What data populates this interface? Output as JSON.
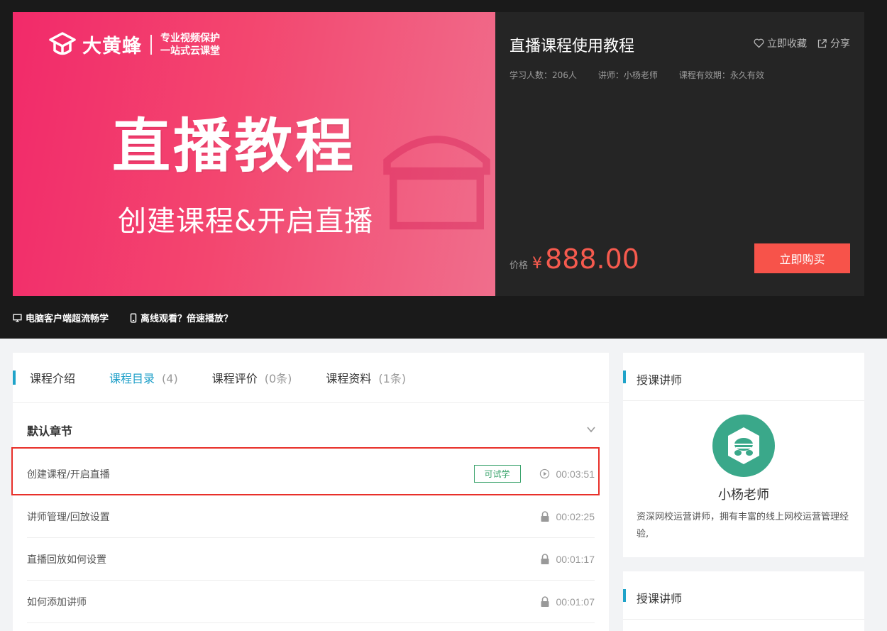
{
  "cover": {
    "brand": "大黄蜂",
    "tagline_line1": "专业视频保护",
    "tagline_line2": "一站式云课堂",
    "big_title": "直播教程",
    "sub_title": "创建课程&开启直播"
  },
  "course": {
    "title": "直播课程使用教程",
    "favorite_label": "立即收藏",
    "share_label": "分享",
    "students": "学习人数：206人",
    "teacher": "讲师：小杨老师",
    "validity": "课程有效期：永久有效",
    "price_label": "价格",
    "currency": "¥",
    "price": "888.00",
    "buy_label": "立即购买"
  },
  "features": {
    "desktop": "电脑客户端超流畅学",
    "offline": "离线观看？倍速播放？"
  },
  "tabs": [
    {
      "label": "课程介绍",
      "count": ""
    },
    {
      "label": "课程目录",
      "count": "(4)"
    },
    {
      "label": "课程评价",
      "count": "(0条)"
    },
    {
      "label": "课程资料",
      "count": "(1条)"
    }
  ],
  "chapter": {
    "title": "默认章节",
    "lessons": [
      {
        "name": "创建课程/开启直播",
        "badge": "可试学",
        "icon": "play-icon",
        "duration": "00:03:51"
      },
      {
        "name": "讲师管理/回放设置",
        "icon": "lock-icon",
        "duration": "00:02:25"
      },
      {
        "name": "直播回放如何设置",
        "icon": "lock-icon",
        "duration": "00:01:17"
      },
      {
        "name": "如何添加讲师",
        "icon": "lock-icon",
        "duration": "00:01:07"
      }
    ]
  },
  "sidebar": {
    "instructor_heading": "授课讲师",
    "instructor_name": "小杨老师",
    "instructor_desc": "资深网校运营讲师，拥有丰富的线上网校运营管理经验,",
    "second_heading": "授课讲师"
  },
  "colors": {
    "accent": "#1fa3c9",
    "price": "#f55a4e",
    "buy_button": "#f7534a",
    "trial_badge": "#3aa36c",
    "highlight_box": "#e8302a"
  }
}
